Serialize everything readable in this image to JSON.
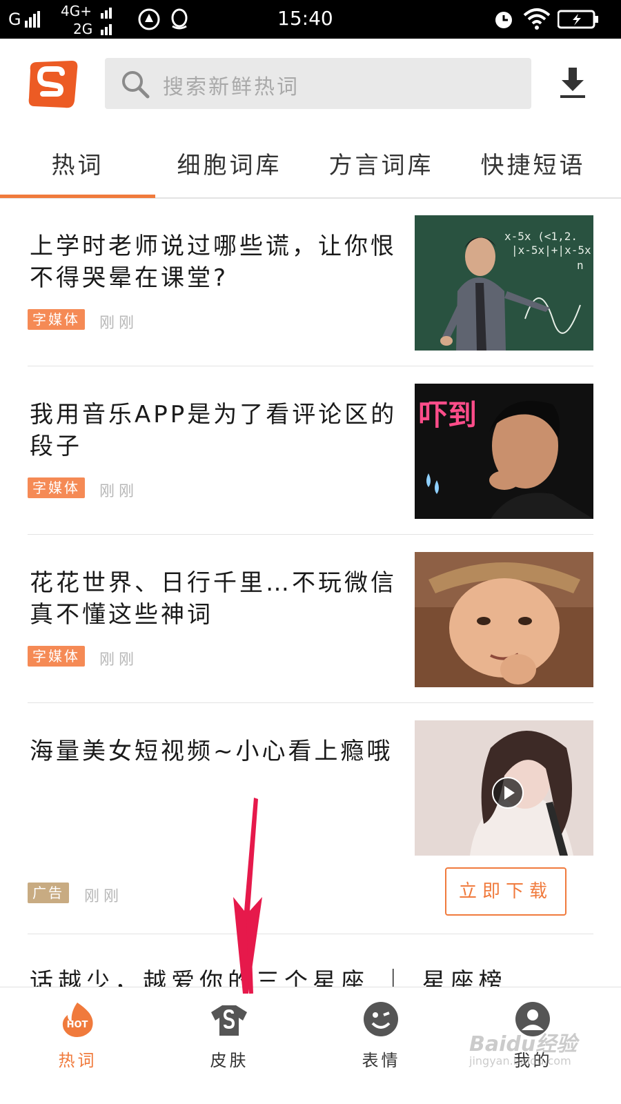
{
  "status_bar": {
    "carrier_1": "G",
    "carrier_2": "4G+",
    "carrier_3": "2G",
    "time": "15:40"
  },
  "header": {
    "search_placeholder": "搜索新鲜热词"
  },
  "tabs": [
    {
      "label": "热词",
      "active": true
    },
    {
      "label": "细胞词库",
      "active": false
    },
    {
      "label": "方言词库",
      "active": false
    },
    {
      "label": "快捷短语",
      "active": false
    }
  ],
  "articles": [
    {
      "title": "上学时老师说过哪些谎，让你恨不得哭晕在课堂?",
      "tag": "字媒体",
      "time": "刚刚"
    },
    {
      "title": "我用音乐APP是为了看评论区的段子",
      "tag": "字媒体",
      "time": "刚刚"
    },
    {
      "title": "花花世界、日行千里…不玩微信真不懂这些神词",
      "tag": "字媒体",
      "time": "刚刚"
    },
    {
      "title": "海量美女短视频~小心看上瘾哦",
      "tag": "广告",
      "time": "刚刚",
      "button": "立即下载"
    }
  ],
  "thumb_texts": {
    "blackboard_1": "x-5x (<1,2.",
    "blackboard_2": "|x-5x|+|x-5x",
    "blackboard_3": "n",
    "sticker": "吓到"
  },
  "partial_article": {
    "title": "话越少，越爱你的三个星座 ｜ 星座榜"
  },
  "bottom_nav": [
    {
      "label": "热词",
      "icon": "hot-icon",
      "badge": "HOT",
      "active": true
    },
    {
      "label": "皮肤",
      "icon": "tshirt-icon",
      "active": false
    },
    {
      "label": "表情",
      "icon": "smiley-icon",
      "active": false
    },
    {
      "label": "我的",
      "icon": "user-icon",
      "active": false
    }
  ],
  "watermark": {
    "line1": "Baidu经验",
    "line2": "jingyan.baidu.com"
  },
  "colors": {
    "accent": "#f07a3c",
    "tag": "#f58a55",
    "ad_tag": "#c8ab82",
    "arrow": "#e6194b"
  }
}
